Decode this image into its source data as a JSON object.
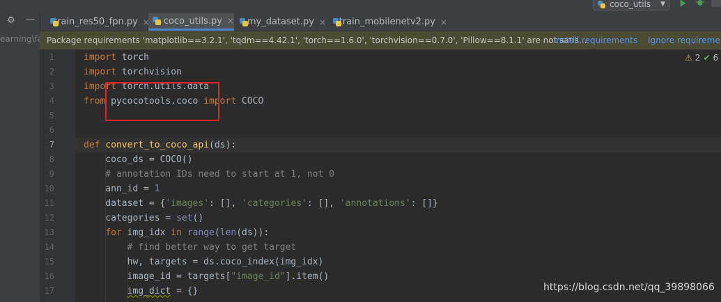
{
  "toolbar": {
    "run_config": "coco_utils",
    "run_icon": "run-icon",
    "debug_icon": "debug-icon",
    "run_color": "#499c54"
  },
  "sidebar": {
    "path_text": "earning\\fa"
  },
  "tabs": [
    {
      "label": "train_res50_fpn.py",
      "active": false
    },
    {
      "label": "coco_utils.py",
      "active": true
    },
    {
      "label": "my_dataset.py",
      "active": false
    },
    {
      "label": "train_mobilenetv2.py",
      "active": false
    }
  ],
  "banner": {
    "message": "Package requirements 'matplotlib==3.2.1', 'tqdm==4.42.1', 'torch==1.6.0', 'torchvision==0.7.0', 'Pillow==8.1.1' are not satis...",
    "install": "Install requirements",
    "ignore": "Ignore requireme"
  },
  "inspections": {
    "warnings": "2",
    "checks": "6"
  },
  "editor": {
    "current_line": 7,
    "line_numbers": [
      "1",
      "2",
      "3",
      "4",
      "5",
      "6",
      "7",
      "8",
      "9",
      "10",
      "11",
      "12",
      "13",
      "14",
      "15",
      "16",
      "17"
    ]
  },
  "code": [
    [
      {
        "c": "kw",
        "t": "import"
      },
      {
        "c": "",
        "t": " torch"
      }
    ],
    [
      {
        "c": "kw",
        "t": "import"
      },
      {
        "c": "",
        "t": " torchvision"
      }
    ],
    [
      {
        "c": "kw",
        "t": "import"
      },
      {
        "c": "",
        "t": " torch.utils.data"
      }
    ],
    [
      {
        "c": "kw",
        "t": "from"
      },
      {
        "c": "",
        "t": " pycocotools.coco "
      },
      {
        "c": "kw",
        "t": "import"
      },
      {
        "c": "",
        "t": " COCO"
      }
    ],
    [],
    [],
    [
      {
        "c": "kw",
        "t": "def"
      },
      {
        "c": "",
        "t": " "
      },
      {
        "c": "fn",
        "t": "convert_to_coco_api"
      },
      {
        "c": "",
        "t": "(ds):"
      }
    ],
    [
      {
        "c": "",
        "t": "    coco_ds = COCO()"
      }
    ],
    [
      {
        "c": "cm",
        "t": "    # annotation IDs need to start at 1, not 0"
      }
    ],
    [
      {
        "c": "",
        "t": "    ann_id = "
      },
      {
        "c": "num",
        "t": "1"
      }
    ],
    [
      {
        "c": "",
        "t": "    dataset = {"
      },
      {
        "c": "str",
        "t": "'images'"
      },
      {
        "c": "",
        "t": ": [], "
      },
      {
        "c": "str",
        "t": "'categories'"
      },
      {
        "c": "",
        "t": ": [], "
      },
      {
        "c": "str",
        "t": "'annotations'"
      },
      {
        "c": "",
        "t": ": []}"
      }
    ],
    [
      {
        "c": "",
        "t": "    categories = "
      },
      {
        "c": "bi",
        "t": "set"
      },
      {
        "c": "",
        "t": "()"
      }
    ],
    [
      {
        "c": "",
        "t": "    "
      },
      {
        "c": "kw",
        "t": "for"
      },
      {
        "c": "",
        "t": " img_idx "
      },
      {
        "c": "kw",
        "t": "in"
      },
      {
        "c": "",
        "t": " "
      },
      {
        "c": "bi",
        "t": "range"
      },
      {
        "c": "",
        "t": "("
      },
      {
        "c": "bi",
        "t": "len"
      },
      {
        "c": "",
        "t": "(ds)):"
      }
    ],
    [
      {
        "c": "cm",
        "t": "        # find better way to get target"
      }
    ],
    [
      {
        "c": "",
        "t": "        hw, targets = ds.coco_index(img_idx)"
      }
    ],
    [
      {
        "c": "",
        "t": "        image_id = targets["
      },
      {
        "c": "str",
        "t": "\"image_id\""
      },
      {
        "c": "",
        "t": "].item()"
      }
    ],
    [
      {
        "c": "",
        "t": "        "
      },
      {
        "c": "squig",
        "t": "img_dict"
      },
      {
        "c": "",
        "t": " = {}"
      }
    ]
  ],
  "watermark": "https://blog.csdn.net/qq_39898066"
}
